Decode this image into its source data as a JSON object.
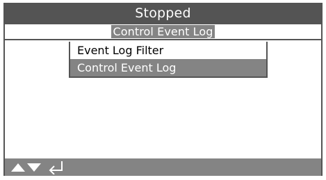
{
  "status": {
    "text": "Stopped"
  },
  "header": {
    "title": "Control Event Log"
  },
  "menu": {
    "items": [
      {
        "label": "Event Log Filter",
        "selected": false
      },
      {
        "label": "Control Event Log",
        "selected": true
      }
    ]
  },
  "footer": {
    "icons": [
      "up-arrow-icon",
      "down-arrow-icon",
      "enter-icon"
    ]
  },
  "colors": {
    "status_bg": "#545454",
    "highlight_bg": "#848484",
    "text_light": "#ffffff",
    "text_dark": "#000000"
  }
}
